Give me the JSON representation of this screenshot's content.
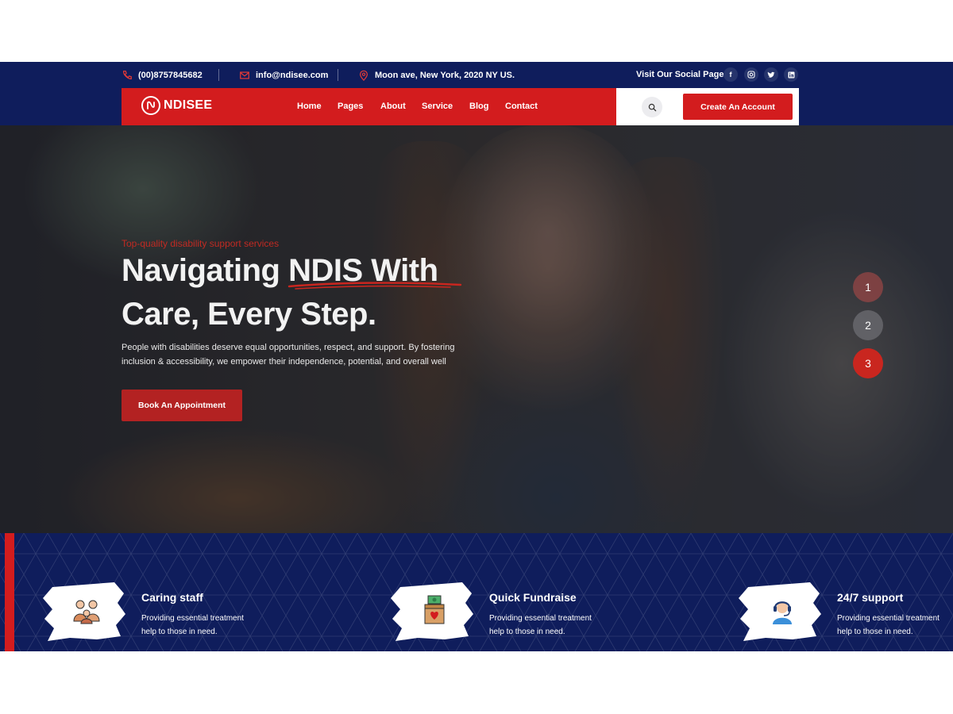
{
  "topbar": {
    "phone": "(00)8757845682",
    "email": "info@ndisee.com",
    "address": "Moon ave, New York, 2020 NY US.",
    "social_label": "Visit Our Social Pages",
    "social_icons": [
      "facebook-icon",
      "instagram-icon",
      "twitter-icon",
      "linkedin-icon"
    ]
  },
  "nav": {
    "logo_text": "NDISEE",
    "links": [
      "Home",
      "Pages",
      "About",
      "Service",
      "Blog",
      "Contact"
    ],
    "cta_label": "Create An Account"
  },
  "hero": {
    "eyebrow": "Top-quality disability support services",
    "headline_line1": "Navigating NDIS With",
    "headline_line2": "Care, Every Step.",
    "description": "People with disabilities deserve equal opportunities, respect, and support. By fostering inclusion & accessibility, we empower their independence, potential, and overall well",
    "button_label": "Book An Appointment",
    "slides": [
      "1",
      "2",
      "3"
    ],
    "active_slide": 3
  },
  "features": [
    {
      "title": "Caring staff",
      "text": "Providing essential treatment help to those in need.",
      "icon": "caregivers-icon"
    },
    {
      "title": "Quick Fundraise",
      "text": "Providing essential treatment help to those in need.",
      "icon": "donation-box-icon"
    },
    {
      "title": "24/7 support",
      "text": "Providing essential treatment help to those in need.",
      "icon": "support-agent-icon"
    }
  ],
  "colors": {
    "navy": "#0f1d5c",
    "brand_red": "#d31c1e",
    "button_red": "#b32222",
    "white": "#ffffff"
  }
}
